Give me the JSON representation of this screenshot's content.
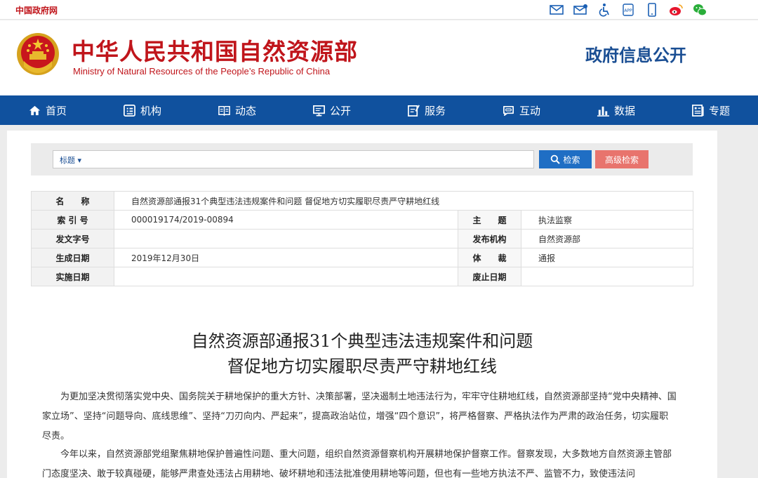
{
  "topbar": {
    "gov_link": "中国政府网",
    "icons": [
      "mail-icon",
      "mail-open-icon",
      "accessibility-icon",
      "app-icon",
      "mobile-icon",
      "weibo-icon",
      "wechat-icon"
    ]
  },
  "header": {
    "title": "中华人民共和国自然资源部",
    "subtitle": "Ministry of Natural Resources of the People’s Republic of China",
    "channel": "政府信息公开"
  },
  "nav": {
    "items": [
      {
        "label": "首页",
        "icon": "home-icon"
      },
      {
        "label": "机构",
        "icon": "org-icon"
      },
      {
        "label": "动态",
        "icon": "book-icon"
      },
      {
        "label": "公开",
        "icon": "monitor-icon"
      },
      {
        "label": "服务",
        "icon": "service-icon"
      },
      {
        "label": "互动",
        "icon": "chat-icon"
      },
      {
        "label": "数据",
        "icon": "bar-chart-icon"
      },
      {
        "label": "专题",
        "icon": "topic-icon"
      }
    ]
  },
  "search": {
    "scope": "标题 ▾",
    "search_label": "检索",
    "advanced_label": "高级检索"
  },
  "meta": {
    "name_label": "名　　称",
    "name_value": "自然资源部通报31个典型违法违规案件和问题 督促地方切实履职尽责严守耕地红线",
    "index_label": "索 引 号",
    "index_value": "000019174/2019-00894",
    "topic_label": "主　　题",
    "topic_value": "执法监察",
    "docno_label": "发文字号",
    "docno_value": "",
    "publisher_label": "发布机构",
    "publisher_value": "自然资源部",
    "date_label": "生成日期",
    "date_value": "2019年12月30日",
    "genre_label": "体　　裁",
    "genre_value": "通报",
    "effective_label": "实施日期",
    "effective_value": "",
    "abolish_label": "废止日期",
    "abolish_value": ""
  },
  "article": {
    "title_line1": "自然资源部通报31个典型违法违规案件和问题",
    "title_line2": "督促地方切实履职尽责严守耕地红线",
    "para1": "为更加坚决贯彻落实党中央、国务院关于耕地保护的重大方针、决策部署，坚决遏制土地违法行为，牢牢守住耕地红线，自然资源部坚持“党中央精神、国家立场”、坚持“问题导向、底线思维”、坚持“刀刃向内、严起来”，提高政治站位，增强“四个意识”，将严格督察、严格执法作为严肃的政治任务，切实履职尽责。",
    "para2": "今年以来，自然资源部党组聚焦耕地保护普遍性问题、重大问题，组织自然资源督察机构开展耕地保护督察工作。督察发现，大多数地方自然资源主管部门态度坚决、敢于较真碰硬，能够严肃查处违法占用耕地、破坏耕地和违法批准使用耕地等问题，但也有一些地方执法不严、监管不力，致使违法问"
  },
  "colors": {
    "brand_red": "#c0151b",
    "nav_blue": "#10519e",
    "search_blue": "#1f6ec4",
    "advanced_red": "#e8746d"
  }
}
